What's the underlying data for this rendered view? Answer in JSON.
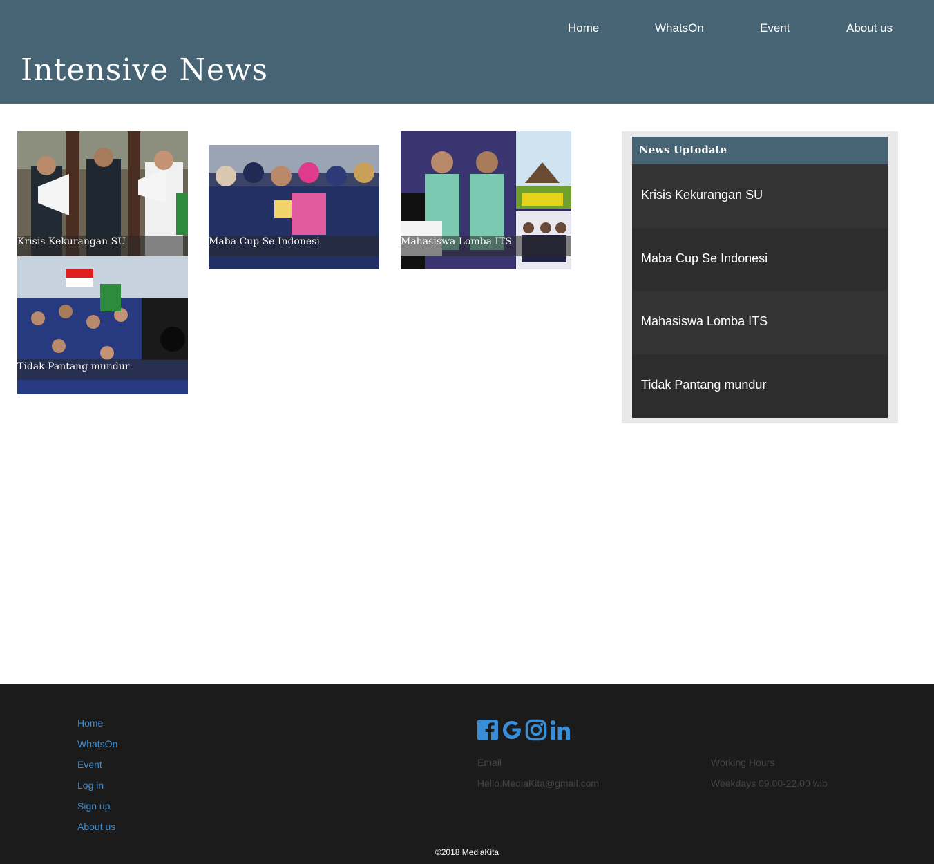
{
  "nav": {
    "home": "Home",
    "whatson": "WhatsOn",
    "event": "Event",
    "about": "About us"
  },
  "site_title": "Intensive News",
  "cards": [
    {
      "title": "Krisis Kekurangan SU"
    },
    {
      "title": "Maba Cup Se Indonesi"
    },
    {
      "title": "Mahasiswa Lomba ITS"
    },
    {
      "title": "Tidak Pantang mundur"
    }
  ],
  "sidebar": {
    "title": "News Uptodate",
    "items": [
      "Krisis Kekurangan SU",
      "Maba Cup Se Indonesi",
      "Mahasiswa Lomba ITS",
      "Tidak Pantang mundur"
    ]
  },
  "footer": {
    "links": [
      "Home",
      "WhatsOn",
      "Event",
      "Log in",
      "Sign up",
      "About us"
    ],
    "social_icons": [
      "facebook-icon",
      "google-icon",
      "instagram-icon",
      "linkedin-icon"
    ],
    "email_label": "Email",
    "email_value": "Hello.MediaKita@gmail.com",
    "hours_label": "Working Hours",
    "hours_value": "Weekdays 09.00-22.00 wib",
    "copyright": "©2018 MediaKita"
  },
  "colors": {
    "header": "#466473",
    "footer": "#1b1b1b",
    "link": "#3a8ed6",
    "sidebar_item": "#333333"
  }
}
